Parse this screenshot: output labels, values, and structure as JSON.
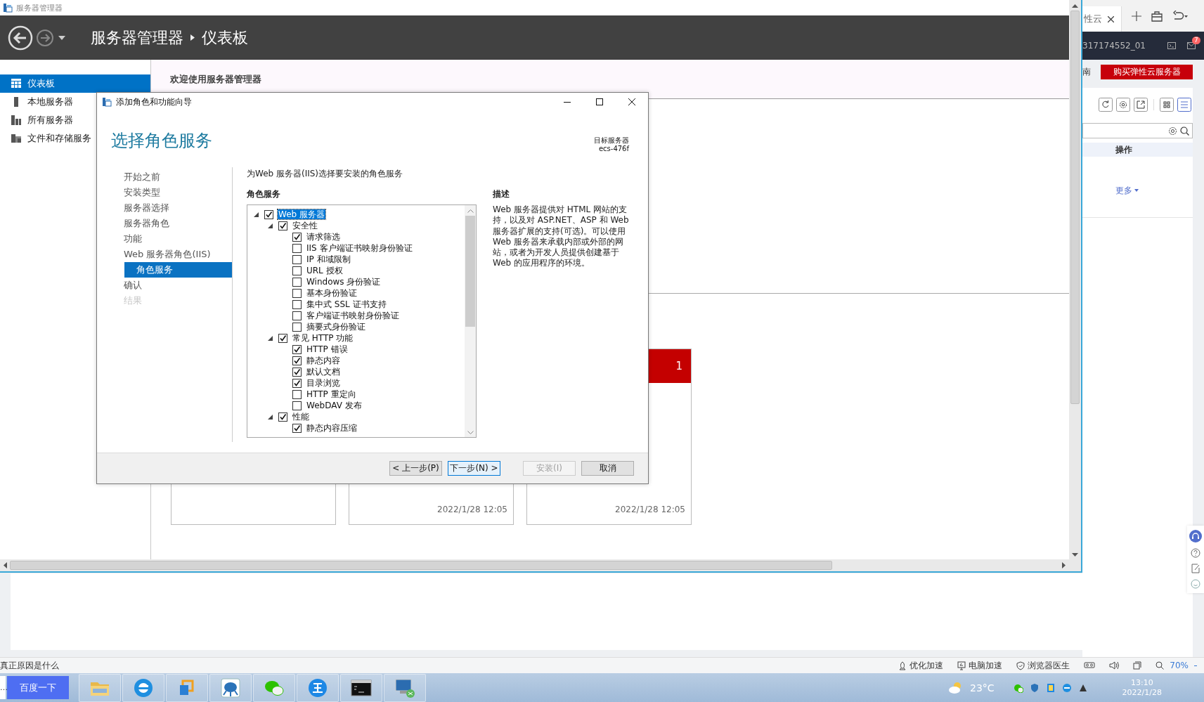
{
  "remote_window": {
    "title": "服务器管理器",
    "breadcrumb": {
      "app": "服务器管理器",
      "page": "仪表板"
    },
    "sidebar": [
      {
        "label": "仪表板",
        "selected": true,
        "kind": "dashboard"
      },
      {
        "label": "本地服务器",
        "selected": false,
        "kind": "server"
      },
      {
        "label": "所有服务器",
        "selected": false,
        "kind": "servers"
      },
      {
        "label": "文件和存储服务",
        "selected": false,
        "kind": "storage"
      }
    ],
    "welcome": "欢迎使用服务器管理器",
    "tiles": [
      {
        "kind": "blank"
      },
      {
        "kind": "dated",
        "time": "2022/1/28 12:05"
      },
      {
        "kind": "alert",
        "count": "1",
        "time": "2022/1/28 12:05"
      }
    ],
    "dialog": {
      "title": "添加角色和功能向导",
      "heading": "选择角色服务",
      "target_label": "目标服务器",
      "target_server": "ecs-476f",
      "steps": [
        {
          "label": "开始之前",
          "selected": false,
          "disabled": false
        },
        {
          "label": "安装类型",
          "selected": false,
          "disabled": false
        },
        {
          "label": "服务器选择",
          "selected": false,
          "disabled": false
        },
        {
          "label": "服务器角色",
          "selected": false,
          "disabled": false
        },
        {
          "label": "功能",
          "selected": false,
          "disabled": false
        },
        {
          "label": "Web 服务器角色(IIS)",
          "selected": false,
          "disabled": false
        },
        {
          "label": "角色服务",
          "selected": true,
          "disabled": false
        },
        {
          "label": "确认",
          "selected": false,
          "disabled": false
        },
        {
          "label": "结果",
          "selected": false,
          "disabled": true
        }
      ],
      "instruction": "为Web 服务器(IIS)选择要安装的角色服务",
      "list_heading": "角色服务",
      "tree": [
        {
          "label": "Web 服务器",
          "checked": true,
          "selected": true,
          "expanded": true,
          "children": [
            {
              "label": "安全性",
              "checked": true,
              "selected": false,
              "expanded": true,
              "children": [
                {
                  "label": "请求筛选",
                  "checked": true,
                  "selected": false
                },
                {
                  "label": "IIS 客户端证书映射身份验证",
                  "checked": false,
                  "selected": false
                },
                {
                  "label": "IP 和域限制",
                  "checked": false,
                  "selected": false
                },
                {
                  "label": "URL 授权",
                  "checked": false,
                  "selected": false
                },
                {
                  "label": "Windows 身份验证",
                  "checked": false,
                  "selected": false
                },
                {
                  "label": "基本身份验证",
                  "checked": false,
                  "selected": false
                },
                {
                  "label": "集中式 SSL 证书支持",
                  "checked": false,
                  "selected": false
                },
                {
                  "label": "客户端证书映射身份验证",
                  "checked": false,
                  "selected": false
                },
                {
                  "label": "摘要式身份验证",
                  "checked": false,
                  "selected": false
                }
              ]
            },
            {
              "label": "常见 HTTP 功能",
              "checked": true,
              "selected": false,
              "expanded": true,
              "children": [
                {
                  "label": "HTTP 错误",
                  "checked": true,
                  "selected": false
                },
                {
                  "label": "静态内容",
                  "checked": true,
                  "selected": false
                },
                {
                  "label": "默认文档",
                  "checked": true,
                  "selected": false
                },
                {
                  "label": "目录浏览",
                  "checked": true,
                  "selected": false
                },
                {
                  "label": "HTTP 重定向",
                  "checked": false,
                  "selected": false
                },
                {
                  "label": "WebDAV 发布",
                  "checked": false,
                  "selected": false
                }
              ]
            },
            {
              "label": "性能",
              "checked": true,
              "selected": false,
              "expanded": true,
              "children": [
                {
                  "label": "静态内容压缩",
                  "checked": true,
                  "selected": false
                }
              ]
            }
          ]
        }
      ],
      "description_heading": "描述",
      "description": "Web 服务器提供对 HTML 网站的支持，以及对 ASP.NET、ASP 和 Web 服务器扩展的支持(可选)。可以使用 Web 服务器来承载内部或外部的网站，或者为开发人员提供创建基于 Web 的应用程序的环境。",
      "buttons": [
        {
          "label": "< 上一步(P)",
          "disabled": false,
          "focused": false
        },
        {
          "label": "下一步(N) >",
          "disabled": false,
          "focused": true
        },
        {
          "label": "安装(I)",
          "disabled": true,
          "focused": false
        },
        {
          "label": "取消",
          "disabled": false,
          "focused": false
        }
      ]
    }
  },
  "browser_page": {
    "tab": "性云",
    "account": "317174552_01",
    "mail_badge": "7",
    "nav_text": "南",
    "buy_button": "购买弹性云服务器",
    "view_toggle": [
      {
        "kind": "grid",
        "selected": false
      },
      {
        "kind": "list",
        "selected": true
      }
    ],
    "column_header": "操作",
    "more_link": "更多"
  },
  "status_bar": {
    "left_text": "真正原因是什么",
    "items": [
      {
        "label": "优化加速",
        "kind": "rocket"
      },
      {
        "label": "电脑加速",
        "kind": "monitor"
      },
      {
        "label": "浏览器医生",
        "kind": "shield"
      }
    ],
    "zoom": "70%"
  },
  "taskbar": {
    "search_value": "…",
    "search_button": "百度一下",
    "apps": [
      {
        "kind": "folder"
      },
      {
        "kind": "ie"
      },
      {
        "kind": "window"
      },
      {
        "kind": "mascot"
      },
      {
        "kind": "chat"
      },
      {
        "kind": "wang"
      },
      {
        "kind": "console"
      },
      {
        "kind": "remote"
      }
    ],
    "temperature": "23°C",
    "time": "13:10",
    "date": "2022/1/28"
  }
}
